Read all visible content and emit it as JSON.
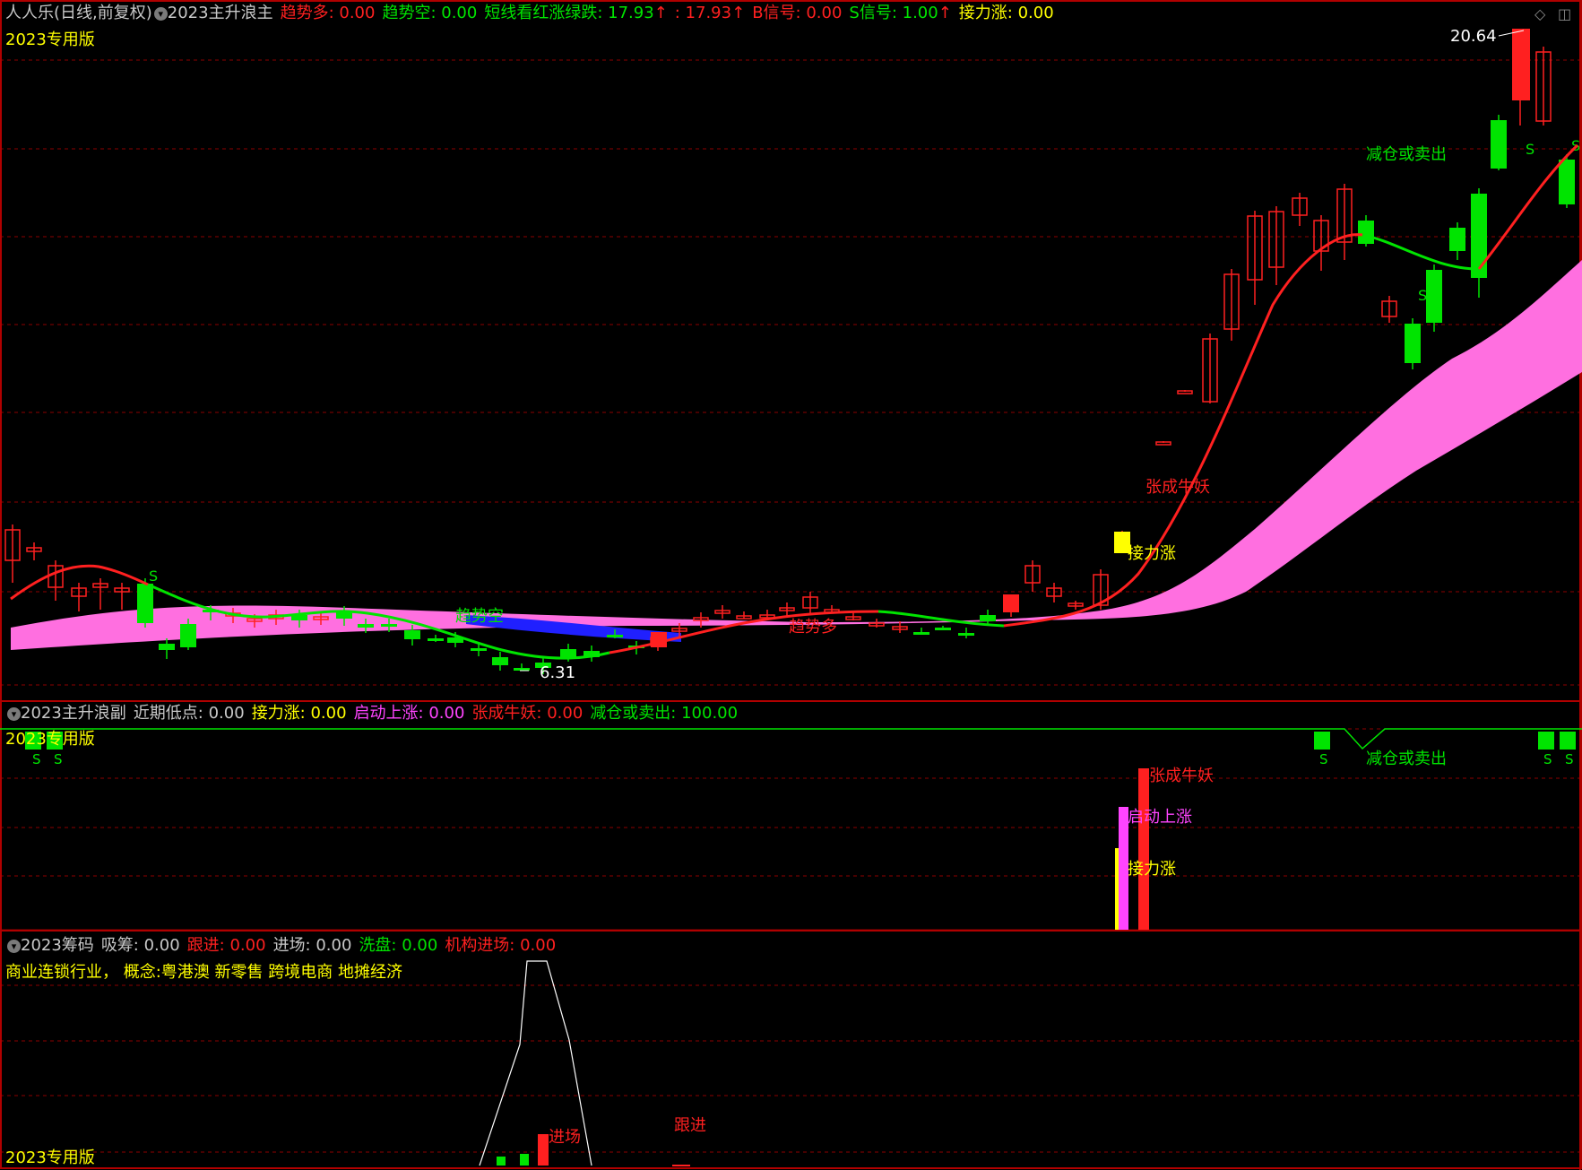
{
  "colors": {
    "up": "#ff2020",
    "down": "#00e400",
    "yellow": "#ffff00",
    "magenta": "#ff44ff",
    "pink_band": "#ff6fe0",
    "blue_band": "#2020ff",
    "grid": "#8b0000",
    "label_gray": "#c8c8c8"
  },
  "header": {
    "stock_name": "人人乐(日线,前复权)",
    "indicator": "2023主升浪主",
    "items": [
      {
        "label": "趋势多",
        "value": ": 0.00",
        "color": "#ff2020"
      },
      {
        "label": "趋势空",
        "value": ": 0.00",
        "color": "#00e400"
      },
      {
        "label": "短线看红涨绿跌",
        "value": ": 17.93",
        "color": "#00e400",
        "arrow": "↑",
        "arrow_color": "#ff2020"
      },
      {
        "label": "",
        "value": ": 17.93",
        "color": "#ff2020",
        "arrow": "↑",
        "arrow_color": "#ff2020"
      },
      {
        "label": "B信号",
        "value": ": 0.00",
        "color": "#ff2020"
      },
      {
        "label": "S信号",
        "value": ": 1.00",
        "color": "#00e400",
        "arrow": "↑",
        "arrow_color": "#ff2020"
      },
      {
        "label": "接力涨",
        "value": ": 0.00",
        "color": "#ffff00"
      }
    ],
    "edition": "2023专用版"
  },
  "main": {
    "price_high_label": "20.64",
    "price_low_label": "6.31",
    "annotations": {
      "trend_short": "趋势空",
      "trend_long": "趋势多",
      "relay": "接力涨",
      "start_rise": "启动上涨",
      "bull_demon": "张成牛妖",
      "reduce_sell": "减仓或卖出",
      "sell_marker": "S"
    }
  },
  "sub": {
    "indicator": "2023主升浪副",
    "items": [
      {
        "label": "近期低点",
        "value": ": 0.00",
        "color": "#c8c8c8"
      },
      {
        "label": "接力涨",
        "value": ": 0.00",
        "color": "#ffff00"
      },
      {
        "label": "启动上涨",
        "value": ": 0.00",
        "color": "#ff44ff"
      },
      {
        "label": "张成牛妖",
        "value": ": 0.00",
        "color": "#ff2020"
      },
      {
        "label": "减仓或卖出",
        "value": ": 100.00",
        "color": "#00e400"
      }
    ],
    "edition": "2023专用版",
    "bar_labels": {
      "bull_demon": "张成牛妖",
      "start_rise": "启动上涨",
      "relay": "接力涨",
      "reduce_sell": "减仓或卖出",
      "sell_marker": "S"
    }
  },
  "chip": {
    "indicator": "2023筹码",
    "items": [
      {
        "label": "吸筹",
        "value": ": 0.00",
        "color": "#c8c8c8"
      },
      {
        "label": "跟进",
        "value": ": 0.00",
        "color": "#ff2020"
      },
      {
        "label": "进场",
        "value": ": 0.00",
        "color": "#c8c8c8"
      },
      {
        "label": "洗盘",
        "value": ": 0.00",
        "color": "#00e400"
      },
      {
        "label": "机构进场",
        "value": ": 0.00",
        "color": "#ff2020"
      }
    ],
    "industry": "商业连锁行业，  概念:粤港澳 新零售 跨境电商 地摊经济",
    "edition": "2023专用版",
    "labels": {
      "enter": "进场",
      "follow": "跟进"
    }
  }
}
